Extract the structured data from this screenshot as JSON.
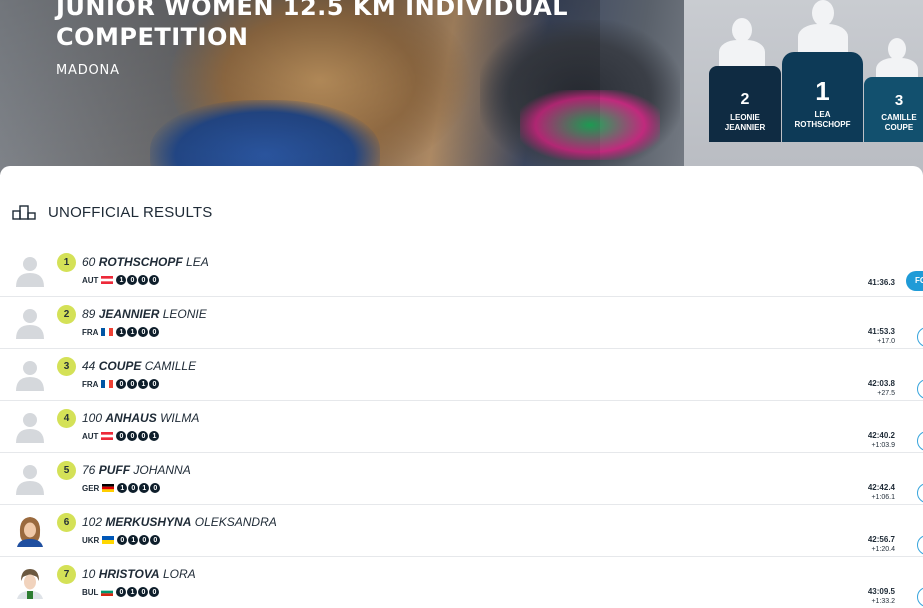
{
  "hero": {
    "title": "JUNIOR WOMEN 12.5 KM INDIVIDUAL COMPETITION",
    "location": "MADONA"
  },
  "podium": [
    {
      "rank": "2",
      "first": "LEONIE",
      "last": "JEANNIER"
    },
    {
      "rank": "1",
      "first": "LEA",
      "last": "ROTHSCHOPF"
    },
    {
      "rank": "3",
      "first": "CAMILLE",
      "last": "COUPE"
    }
  ],
  "results": {
    "title": "UNOFFICIAL RESULTS",
    "follow_label": "FO",
    "rows": [
      {
        "rank": "1",
        "bib": "60",
        "last": "ROTHSCHOPF",
        "first": "LEA",
        "nat": "AUT",
        "flag": "aut",
        "shooting": [
          "1",
          "0",
          "0",
          "0"
        ],
        "time": "41:36.3",
        "behind": "",
        "avatar": "silhouette"
      },
      {
        "rank": "2",
        "bib": "89",
        "last": "JEANNIER",
        "first": "LEONIE",
        "nat": "FRA",
        "flag": "fra",
        "shooting": [
          "1",
          "1",
          "0",
          "0"
        ],
        "time": "41:53.3",
        "behind": "+17.0",
        "avatar": "silhouette"
      },
      {
        "rank": "3",
        "bib": "44",
        "last": "COUPE",
        "first": "CAMILLE",
        "nat": "FRA",
        "flag": "fra",
        "shooting": [
          "0",
          "0",
          "1",
          "0"
        ],
        "time": "42:03.8",
        "behind": "+27.5",
        "avatar": "silhouette"
      },
      {
        "rank": "4",
        "bib": "100",
        "last": "ANHAUS",
        "first": "WILMA",
        "nat": "AUT",
        "flag": "aut",
        "shooting": [
          "0",
          "0",
          "0",
          "1"
        ],
        "time": "42:40.2",
        "behind": "+1:03.9",
        "avatar": "silhouette"
      },
      {
        "rank": "5",
        "bib": "76",
        "last": "PUFF",
        "first": "JOHANNA",
        "nat": "GER",
        "flag": "ger",
        "shooting": [
          "1",
          "0",
          "1",
          "0"
        ],
        "time": "42:42.4",
        "behind": "+1:06.1",
        "avatar": "silhouette"
      },
      {
        "rank": "6",
        "bib": "102",
        "last": "MERKUSHYNA",
        "first": "OLEKSANDRA",
        "nat": "UKR",
        "flag": "ukr",
        "shooting": [
          "0",
          "1",
          "0",
          "0"
        ],
        "time": "42:56.7",
        "behind": "+1:20.4",
        "avatar": "photo-a"
      },
      {
        "rank": "7",
        "bib": "10",
        "last": "HRISTOVA",
        "first": "LORA",
        "nat": "BUL",
        "flag": "bul",
        "shooting": [
          "0",
          "1",
          "0",
          "0"
        ],
        "time": "43:09.5",
        "behind": "+1:33.2",
        "avatar": "photo-b"
      }
    ]
  },
  "colors": {
    "rank_badge": "#d4e157",
    "podium_dark": "#0f2b42",
    "podium_mid": "#0d3a57",
    "podium_light": "#12506e",
    "accent_blue": "#1f9bd7"
  }
}
